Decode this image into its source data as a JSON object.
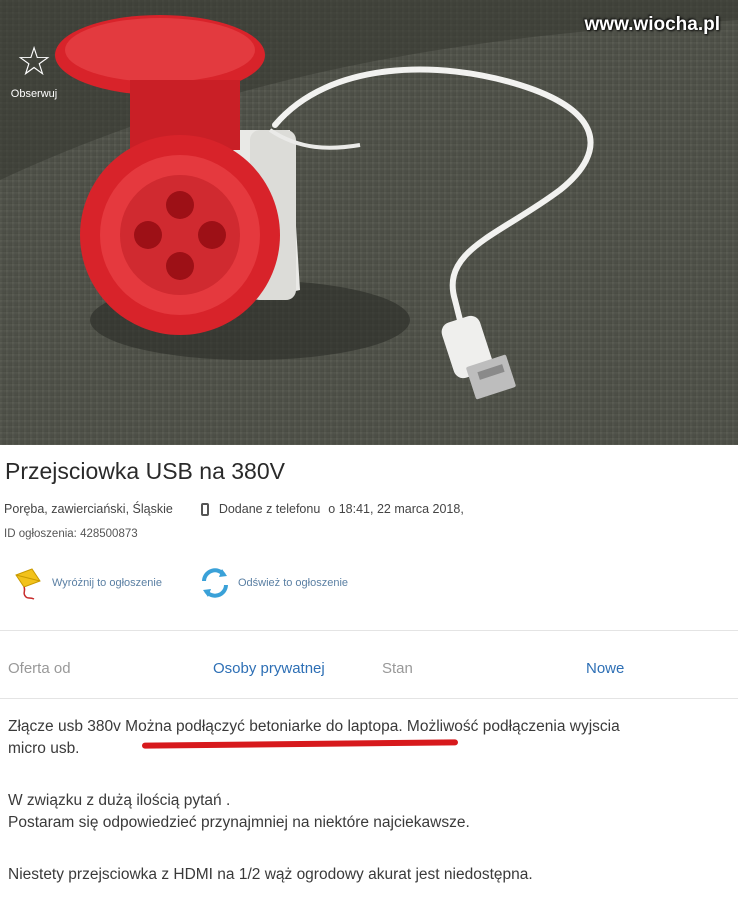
{
  "watermark": "www.wiocha.pl",
  "observe": {
    "label": "Obserwuj",
    "icon": "star-icon"
  },
  "listing": {
    "title": "Przejsciowka USB na 380V",
    "location": "Poręba, zawierciański, Śląskie",
    "added_from": "Dodane z telefonu",
    "added_at": "o 18:41, 22 marca 2018,",
    "ad_id": "ID ogłoszenia: 428500873"
  },
  "actions": [
    {
      "label": "Wyróżnij to ogłoszenie",
      "icon": "kite-icon"
    },
    {
      "label": "Odśwież to ogłoszenie",
      "icon": "refresh-icon"
    }
  ],
  "params": {
    "offer_key": "Oferta od",
    "offer_value": "Osoby prywatnej",
    "state_key": "Stan",
    "state_value": "Nowe"
  },
  "description": {
    "line1": "Złącze usb 380v Można podłączyć betoniarke do laptopa. Możliwość podłączenia wyjscia",
    "line2": "micro usb.",
    "line3": "W związku z dużą ilością pytań .",
    "line4": "Postaram się odpowiedzieć przynajmniej na niektóre najciekawsze.",
    "line5": "Niestety przejsciowka z HDMI na 1/2 wąż ogrodowy akurat jest niedostępna."
  },
  "colors": {
    "link": "#2d6fb5",
    "underline": "#d7191c",
    "plug_red": "#d8232a"
  }
}
